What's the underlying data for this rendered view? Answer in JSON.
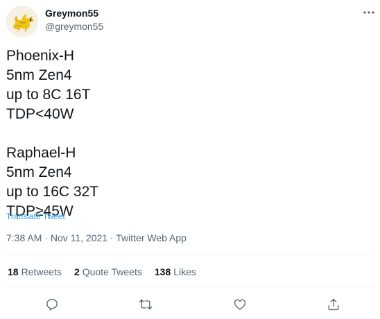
{
  "author": {
    "display_name": "Greymon55",
    "handle": "@greymon55"
  },
  "tweet": {
    "text": "Phoenix-H\n5nm Zen4\nup to 8C 16T\nTDP<40W\n\nRaphael-H\n5nm Zen4\nup to 16C 32T\nTDP≥45W",
    "translate_label": "Translate Tweet",
    "time": "7:38 AM",
    "separator": " · ",
    "date": "Nov 11, 2021",
    "source": "Twitter Web App"
  },
  "stats": {
    "retweets_count": "18",
    "retweets_label": "Retweets",
    "quote_count": "2",
    "quote_label": "Quote Tweets",
    "likes_count": "138",
    "likes_label": "Likes"
  },
  "icons": {
    "more": "more-horizontal-icon",
    "reply": "reply-icon",
    "retweet": "retweet-icon",
    "like": "heart-icon",
    "share": "share-icon"
  },
  "colors": {
    "link": "#1d9bf0",
    "secondary_text": "#536471",
    "primary_text": "#0f1419"
  }
}
